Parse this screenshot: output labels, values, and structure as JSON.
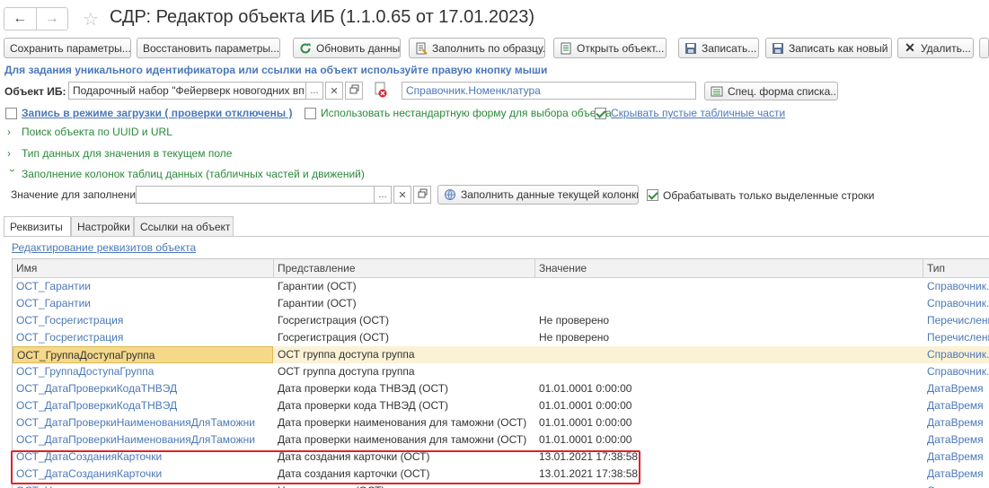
{
  "window": {
    "title": "СДР: Редактор объекта ИБ (1.1.0.65 от 17.01.2023)",
    "nav_back": "←",
    "nav_forward": "→",
    "star": "☆"
  },
  "toolbar": {
    "save_params": "Сохранить параметры...",
    "restore_params": "Восстановить параметры...",
    "refresh": "Обновить данные",
    "fill_by_sample": "Заполнить по образцу...",
    "open_object": "Открыть объект...",
    "write": "Записать...",
    "write_as_new": "Записать как новый",
    "delete": "Удалить..."
  },
  "hint": "Для задания уникального идентификатора или ссылки на объект используйте правую кнопку мыши",
  "object": {
    "label": "Объект ИБ:",
    "value": "Подарочный набор \"Фейерверк новогодних вп",
    "type_value": "Справочник.Номенклатура",
    "spec_form_button": "Спец. форма списка..."
  },
  "options": {
    "load_mode": "Запись в режиме загрузки ( проверки отключены )",
    "load_mode_checked": false,
    "nonstandard_form": "Использовать нестандартную форму для выбора объекта",
    "nonstandard_form_checked": false,
    "hide_empty": "Скрывать пустые табличные части",
    "hide_empty_checked": true
  },
  "sections": {
    "search_uuid": "Поиск объекта по UUID и URL",
    "data_type": "Тип данных для значения в текущем поле",
    "fill_columns": "Заполнение колонок таблиц данных (табличных частей и движений)"
  },
  "fill": {
    "label": "Значение для заполнения:",
    "value": "",
    "button": "Заполнить данные текущей колонки",
    "only_selected": "Обрабатывать только выделенные строки",
    "only_selected_checked": true
  },
  "tabs": [
    {
      "label": "Реквизиты",
      "active": true
    },
    {
      "label": "Настройки",
      "active": false
    },
    {
      "label": "Ссылки на объект",
      "active": false
    }
  ],
  "edit_link": "Редактирование реквизитов объекта",
  "table": {
    "columns": [
      "Имя",
      "Представление",
      "Значение",
      "Тип"
    ],
    "rows": [
      {
        "name": "ОСТ_Гарантии",
        "pres": "Гарантии (ОСТ)",
        "value": "",
        "type": "Справочник.С"
      },
      {
        "name": "ОСТ_Гарантии",
        "pres": "Гарантии (ОСТ)",
        "value": "",
        "type": "Справочник.С"
      },
      {
        "name": "ОСТ_Госрегистрация",
        "pres": "Госрегистрация (ОСТ)",
        "value": "Не проверено",
        "type": "Перечисление"
      },
      {
        "name": "ОСТ_Госрегистрация",
        "pres": "Госрегистрация (ОСТ)",
        "value": "Не проверено",
        "type": "Перечисление"
      },
      {
        "name": "ОСТ_ГруппаДоступаГруппа",
        "pres": "ОСТ группа доступа группа",
        "value": "",
        "type": "Справочник.Г",
        "selected": true
      },
      {
        "name": "ОСТ_ГруппаДоступаГруппа",
        "pres": "ОСТ группа доступа группа",
        "value": "",
        "type": "Справочник.Г"
      },
      {
        "name": "ОСТ_ДатаПроверкиКодаТНВЭД",
        "pres": "Дата проверки кода ТНВЭД (ОСТ)",
        "value": "01.01.0001 0:00:00",
        "type": "ДатаВремя"
      },
      {
        "name": "ОСТ_ДатаПроверкиКодаТНВЭД",
        "pres": "Дата проверки кода ТНВЭД (ОСТ)",
        "value": "01.01.0001 0:00:00",
        "type": "ДатаВремя"
      },
      {
        "name": "ОСТ_ДатаПроверкиНаименованияДляТаможни",
        "pres": "Дата проверки наименования для таможни (ОСТ)",
        "value": "01.01.0001 0:00:00",
        "type": "ДатаВремя"
      },
      {
        "name": "ОСТ_ДатаПроверкиНаименованияДляТаможни",
        "pres": "Дата проверки наименования для таможни (ОСТ)",
        "value": "01.01.0001 0:00:00",
        "type": "ДатаВремя"
      },
      {
        "name": "ОСТ_ДатаСозданияКарточки",
        "pres": "Дата создания карточки (ОСТ)",
        "value": "13.01.2021 17:38:58",
        "type": "ДатаВремя"
      },
      {
        "name": "ОСТ_ДатаСозданияКарточки",
        "pres": "Дата создания карточки (ОСТ)",
        "value": "13.01.2021 17:38:58",
        "type": "ДатаВремя"
      },
      {
        "name": "ОСТ_Наименование",
        "pres": "Наименование (ОСТ)",
        "value": "",
        "type": "Строка"
      }
    ]
  },
  "colors": {
    "link": "#4b78b8",
    "section_green": "#2a8a3a",
    "selected_row": "#fbf2d5",
    "highlight_border": "#e0212b"
  }
}
